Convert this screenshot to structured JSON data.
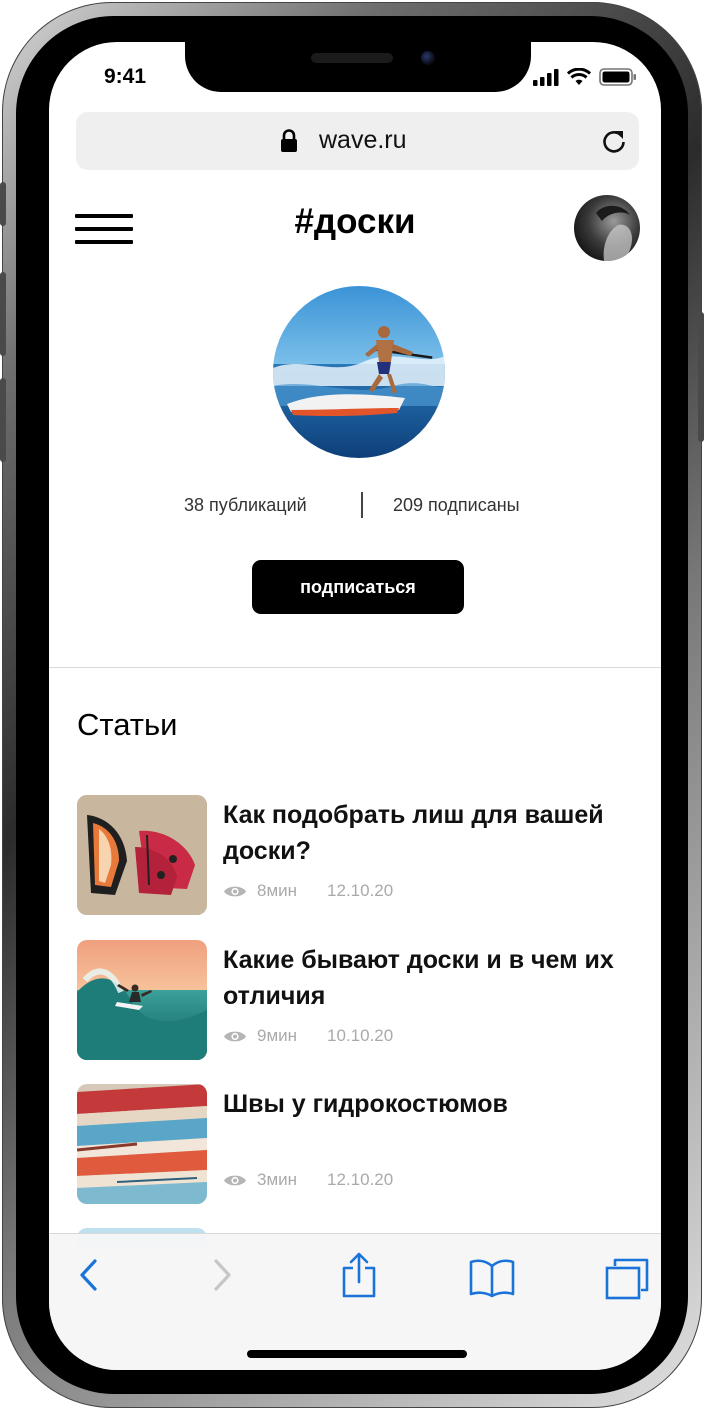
{
  "status_bar": {
    "time": "9:41"
  },
  "browser": {
    "url": "wave.ru"
  },
  "header": {
    "title": "#доски"
  },
  "profile": {
    "publications": "38 публикаций",
    "subscribers": "209 подписаны",
    "subscribe_label": "подписаться"
  },
  "articles_section": {
    "title": "Статьи",
    "items": [
      {
        "title": "Как подобрать лиш для вашей доски?",
        "read_time": "8мин",
        "date": "12.10.20"
      },
      {
        "title": "Какие бывают доски и в чем их отличия",
        "read_time": "9мин",
        "date": "10.10.20"
      },
      {
        "title": "Швы у гидрокостюмов",
        "read_time": "3мин",
        "date": "12.10.20"
      }
    ]
  },
  "toolbar": {
    "icons": [
      "back-icon",
      "forward-icon",
      "share-icon",
      "bookmarks-icon",
      "tabs-icon"
    ],
    "accent_color": "#1a73d9"
  }
}
